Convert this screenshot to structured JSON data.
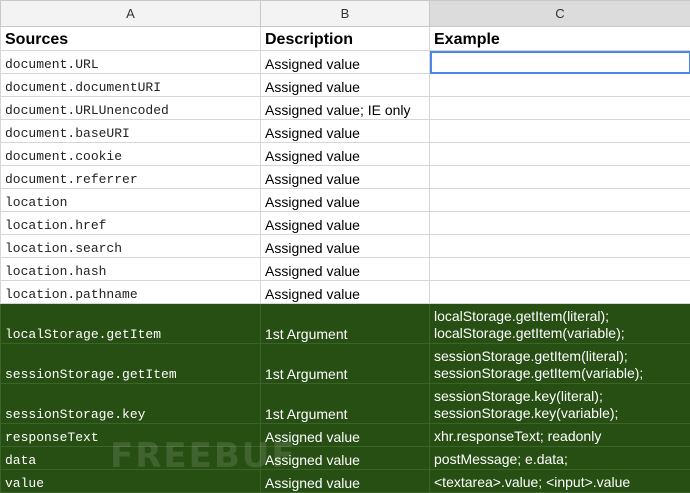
{
  "columns": [
    "A",
    "B",
    "C"
  ],
  "header_row": {
    "sources": "Sources",
    "description": "Description",
    "example": "Example"
  },
  "rows": [
    {
      "source": "document.URL",
      "description": "Assigned value",
      "example": []
    },
    {
      "source": "document.documentURI",
      "description": "Assigned value",
      "example": []
    },
    {
      "source": "document.URLUnencoded",
      "description": "Assigned value; IE only",
      "example": []
    },
    {
      "source": "document.baseURI",
      "description": "Assigned value",
      "example": []
    },
    {
      "source": "document.cookie",
      "description": "Assigned value",
      "example": []
    },
    {
      "source": "document.referrer",
      "description": "Assigned value",
      "example": []
    },
    {
      "source": "location",
      "description": "Assigned value",
      "example": []
    },
    {
      "source": "location.href",
      "description": "Assigned value",
      "example": []
    },
    {
      "source": "location.search",
      "description": "Assigned value",
      "example": []
    },
    {
      "source": "location.hash",
      "description": "Assigned value",
      "example": []
    },
    {
      "source": "location.pathname",
      "description": "Assigned value",
      "example": []
    },
    {
      "source": "localStorage.getItem",
      "description": "1st Argument",
      "example": [
        "localStorage.getItem(literal);",
        "localStorage.getItem(variable);"
      ]
    },
    {
      "source": "sessionStorage.getItem",
      "description": "1st Argument",
      "example": [
        "sessionStorage.getItem(literal);",
        "sessionStorage.getItem(variable);"
      ]
    },
    {
      "source": "sessionStorage.key",
      "description": "1st Argument",
      "example": [
        "sessionStorage.key(literal);",
        "sessionStorage.key(variable);"
      ]
    },
    {
      "source": "responseText",
      "description": "Assigned value",
      "example": [
        "xhr.responseText; readonly"
      ]
    },
    {
      "source": "data",
      "description": "Assigned value",
      "example": [
        "postMessage; e.data;"
      ]
    },
    {
      "source": "value",
      "description": "Assigned value",
      "example": [
        "<textarea>.value; <input>.value"
      ]
    }
  ],
  "watermark": "FREEBUF",
  "colors": {
    "highlight_fill": "#274e13",
    "selection_border": "#4a86e8",
    "grid": "#d6d6d6"
  }
}
